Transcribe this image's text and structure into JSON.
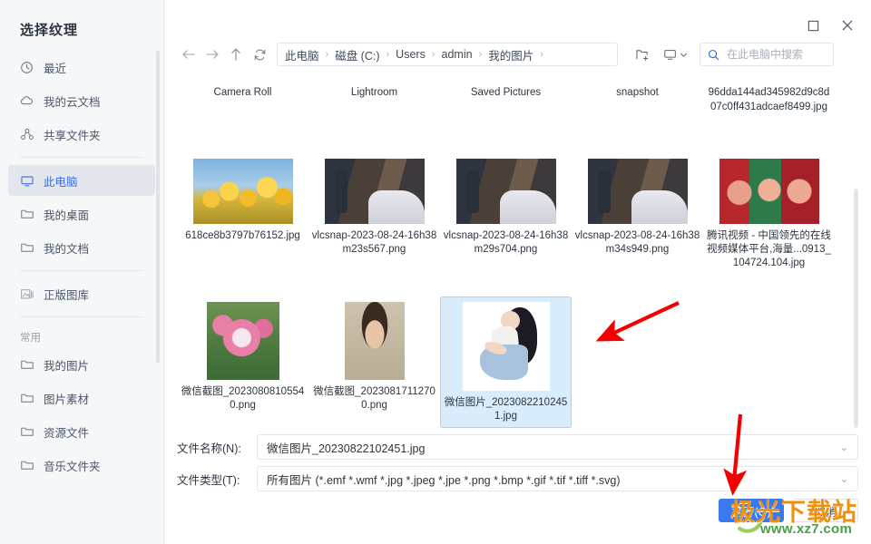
{
  "sidebar": {
    "title": "选择纹理",
    "items": [
      {
        "label": "最近",
        "icon": "clock-icon",
        "active": false
      },
      {
        "label": "我的云文档",
        "icon": "cloud-icon",
        "active": false
      },
      {
        "label": "共享文件夹",
        "icon": "share-icon",
        "active": false
      },
      {
        "label": "此电脑",
        "icon": "monitor-icon",
        "active": true
      },
      {
        "label": "我的桌面",
        "icon": "folder-icon",
        "active": false
      },
      {
        "label": "我的文档",
        "icon": "folder-icon",
        "active": false
      },
      {
        "label": "正版图库",
        "icon": "image-library-icon",
        "active": false
      }
    ],
    "group_label": "常用",
    "group_items": [
      {
        "label": "我的图片",
        "icon": "folder-icon"
      },
      {
        "label": "图片素材",
        "icon": "folder-icon"
      },
      {
        "label": "资源文件",
        "icon": "folder-icon"
      },
      {
        "label": "音乐文件夹",
        "icon": "folder-icon"
      }
    ]
  },
  "window": {
    "maximize_label": "maximize-icon",
    "close_label": "close-icon"
  },
  "toolbar": {
    "back": "back-icon",
    "forward": "forward-icon",
    "up": "up-icon",
    "refresh": "refresh-icon",
    "new_folder": "new-folder-icon",
    "view": "view-mode-icon",
    "breadcrumbs": [
      "此电脑",
      "磁盘 (C:)",
      "Users",
      "admin",
      "我的图片"
    ],
    "crumb_separator": "›"
  },
  "search": {
    "placeholder": "在此电脑中搜索",
    "value": "",
    "icon": "search-icon"
  },
  "files": {
    "rows": [
      [
        {
          "name": "Camera Roll",
          "thumb": "none",
          "selected": false
        },
        {
          "name": "Lightroom",
          "thumb": "none",
          "selected": false
        },
        {
          "name": "Saved Pictures",
          "thumb": "none",
          "selected": false
        },
        {
          "name": "snapshot",
          "thumb": "none",
          "selected": false
        },
        {
          "name": "96dda144ad345982d9c8d07c0ff431adcaef8499.jpg",
          "thumb": "none",
          "selected": false
        }
      ],
      [
        {
          "name": "618ce8b3797b76152.jpg",
          "thumb": "tulip",
          "selected": false
        },
        {
          "name": "vlcsnap-2023-08-24-16h38m23s567.png",
          "thumb": "bed",
          "selected": false
        },
        {
          "name": "vlcsnap-2023-08-24-16h38m29s704.png",
          "thumb": "bed",
          "selected": false
        },
        {
          "name": "vlcsnap-2023-08-24-16h38m34s949.png",
          "thumb": "bed",
          "selected": false
        },
        {
          "name": "腾讯视频 - 中国领先的在线视频媒体平台,海量...0913_104724.104.jpg",
          "thumb": "girls",
          "selected": false
        }
      ],
      [
        {
          "name": "微信截图_20230808105540.png",
          "thumb": "lotus",
          "selected": false
        },
        {
          "name": "微信截图_20230817112700.png",
          "thumb": "portrait",
          "selected": false
        },
        {
          "name": "微信图片_20230822102451.jpg",
          "thumb": "lady",
          "selected": true
        }
      ]
    ]
  },
  "form": {
    "filename_label": "文件名称(N):",
    "filename_value": "微信图片_20230822102451.jpg",
    "filetype_label": "文件类型(T):",
    "filetype_value": "所有图片 (*.emf *.wmf *.jpg *.jpeg *.jpe *.png *.bmp *.gif *.tif *.tiff *.svg)",
    "caret": "⌄"
  },
  "buttons": {
    "open": "打开(O)",
    "cancel": "取消",
    "accent": "#3a7af0"
  },
  "watermark": {
    "text": "极光下载站",
    "url": "www.xz7.com",
    "text_color": "#f2900d",
    "url_color": "#46a046"
  },
  "annotations": {
    "arrow_color": "#f40000",
    "arrow1": "points-to-selected-file",
    "arrow2": "points-to-open-button"
  }
}
